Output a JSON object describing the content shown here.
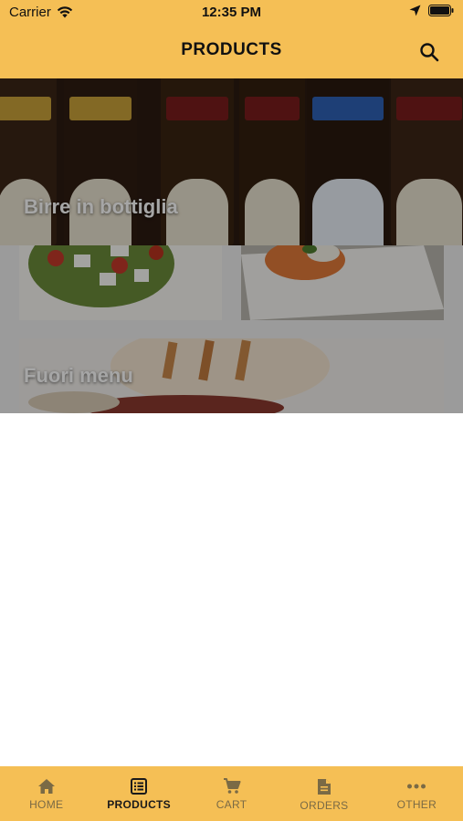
{
  "status_bar": {
    "carrier": "Carrier",
    "time": "12:35 PM"
  },
  "header": {
    "title": "PRODUCTS",
    "search_icon": "search-icon"
  },
  "categories": [
    {
      "label": "Birre in bottiglia"
    },
    {
      "label": "Fuori menu"
    }
  ],
  "tabs": [
    {
      "label": "HOME",
      "icon": "home-icon",
      "active": false
    },
    {
      "label": "PRODUCTS",
      "icon": "list-icon",
      "active": true
    },
    {
      "label": "CART",
      "icon": "cart-icon",
      "active": false
    },
    {
      "label": "ORDERS",
      "icon": "document-icon",
      "active": false
    },
    {
      "label": "OTHER",
      "icon": "more-icon",
      "active": false
    }
  ],
  "colors": {
    "accent": "#f5bf55",
    "active_tab": "#1a1a1a",
    "inactive_tab": "#7a6a45"
  }
}
